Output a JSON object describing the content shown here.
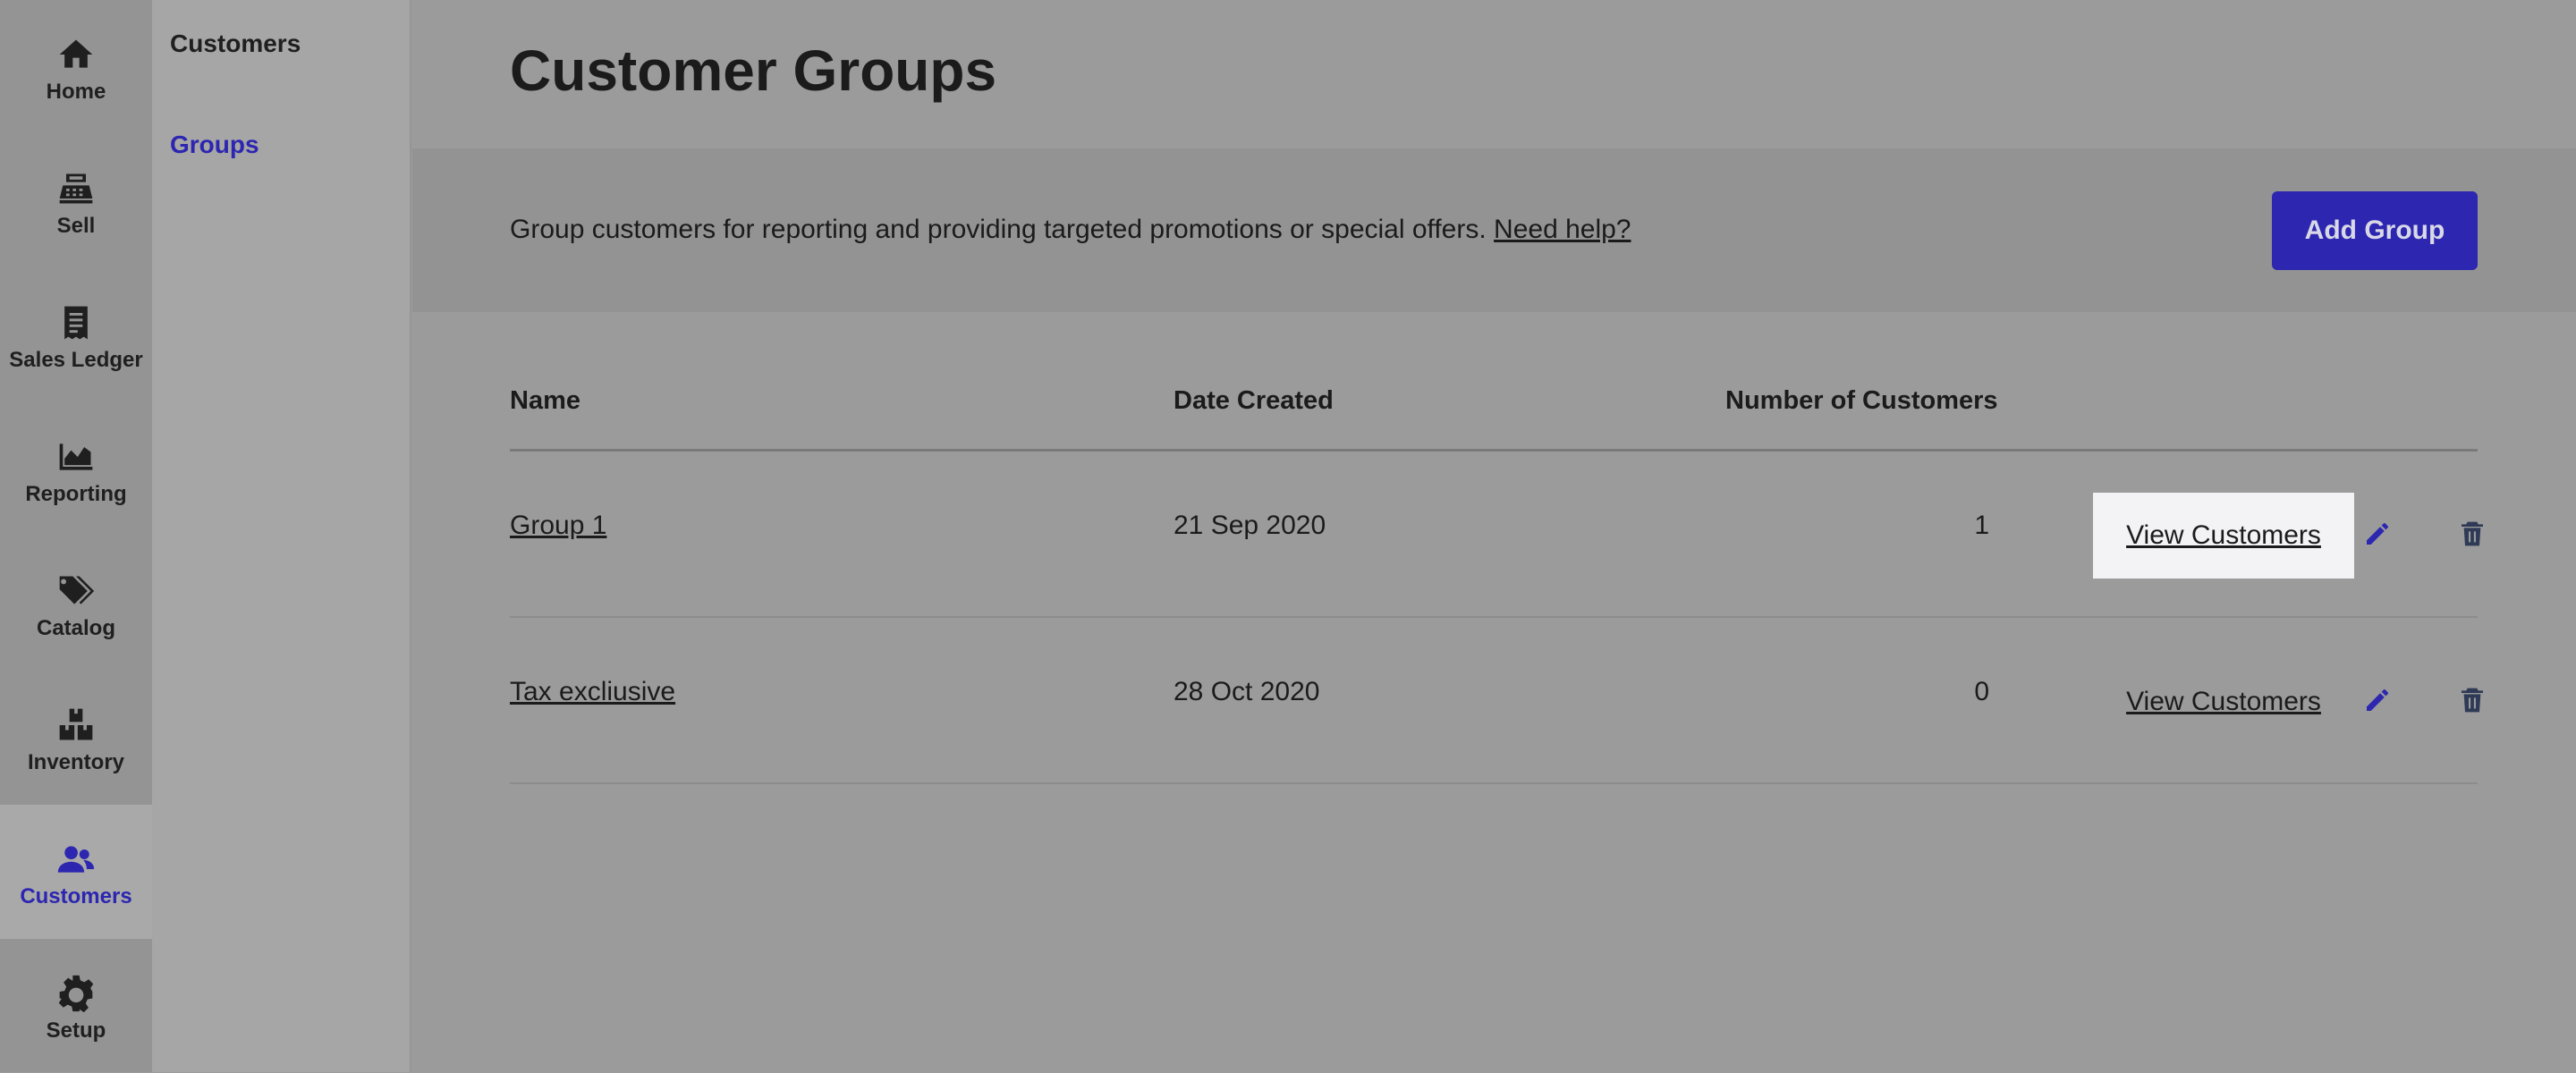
{
  "rail": {
    "items": [
      {
        "label": "Home",
        "icon": "home-icon",
        "active": false
      },
      {
        "label": "Sell",
        "icon": "register-icon",
        "active": false
      },
      {
        "label": "Sales Ledger",
        "icon": "receipt-icon",
        "active": false
      },
      {
        "label": "Reporting",
        "icon": "chart-icon",
        "active": false
      },
      {
        "label": "Catalog",
        "icon": "tags-icon",
        "active": false
      },
      {
        "label": "Inventory",
        "icon": "boxes-icon",
        "active": false
      },
      {
        "label": "Customers",
        "icon": "users-icon",
        "active": true
      },
      {
        "label": "Setup",
        "icon": "gear-icon",
        "active": false
      }
    ]
  },
  "subnav": {
    "title": "Customers",
    "items": [
      {
        "label": "Groups"
      }
    ]
  },
  "page": {
    "title": "Customer Groups",
    "info_text": "Group customers for reporting and providing targeted promotions or special offers.",
    "help_link": "Need help?",
    "add_button": "Add Group"
  },
  "table": {
    "headers": {
      "name": "Name",
      "date": "Date Created",
      "count": "Number of Customers"
    },
    "rows": [
      {
        "name": "Group 1",
        "date": "21 Sep 2020",
        "count": "1",
        "action": "View Customers"
      },
      {
        "name": "Tax excliusive",
        "date": "28 Oct 2020",
        "count": "0",
        "action": "View Customers"
      }
    ]
  },
  "colors": {
    "accent": "#2c26b0",
    "rail_bg": "#949494",
    "subnav_bg": "#a6a6a6",
    "main_bg": "#9b9b9b"
  }
}
